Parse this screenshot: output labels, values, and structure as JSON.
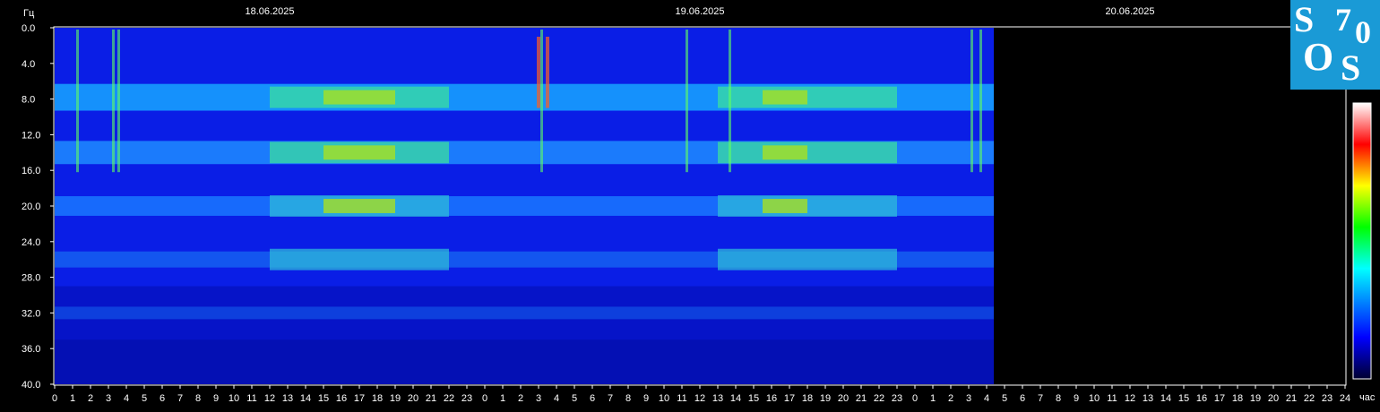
{
  "chart_data": {
    "type": "heatmap",
    "ylabel": "Гц",
    "xlabel": "час",
    "y_ticks": [
      "0.0",
      "4.0",
      "8.0",
      "12.0",
      "16.0",
      "20.0",
      "24.0",
      "28.0",
      "32.0",
      "36.0",
      "40.0"
    ],
    "ylim": [
      0,
      40
    ],
    "x_ticks": [
      "0",
      "1",
      "2",
      "3",
      "4",
      "5",
      "6",
      "7",
      "8",
      "9",
      "10",
      "11",
      "12",
      "13",
      "14",
      "15",
      "16",
      "17",
      "18",
      "19",
      "20",
      "21",
      "22",
      "23",
      "0",
      "1",
      "2",
      "3",
      "4",
      "5",
      "6",
      "7",
      "8",
      "9",
      "10",
      "11",
      "12",
      "13",
      "14",
      "15",
      "16",
      "17",
      "18",
      "19",
      "20",
      "21",
      "22",
      "23",
      "0",
      "1",
      "2",
      "3",
      "4",
      "5",
      "6",
      "7",
      "8",
      "9",
      "10",
      "11",
      "12",
      "13",
      "14",
      "15",
      "16",
      "17",
      "18",
      "19",
      "20",
      "21",
      "22",
      "23",
      "24"
    ],
    "dates": [
      "18.06.2025",
      "19.06.2025",
      "20.06.2025"
    ],
    "data_end_hour": 52.4,
    "resonance_bands_hz": [
      7.8,
      14.0,
      20.0,
      26.0,
      32.0
    ],
    "colorbar": [
      "#000040",
      "#0000ff",
      "#00ffff",
      "#00ff00",
      "#ffff00",
      "#ff0000",
      "#ffffff"
    ]
  },
  "logo": {
    "letters": [
      "S",
      "7",
      "0",
      "O",
      "S"
    ],
    "color": "#1a9ad6"
  }
}
